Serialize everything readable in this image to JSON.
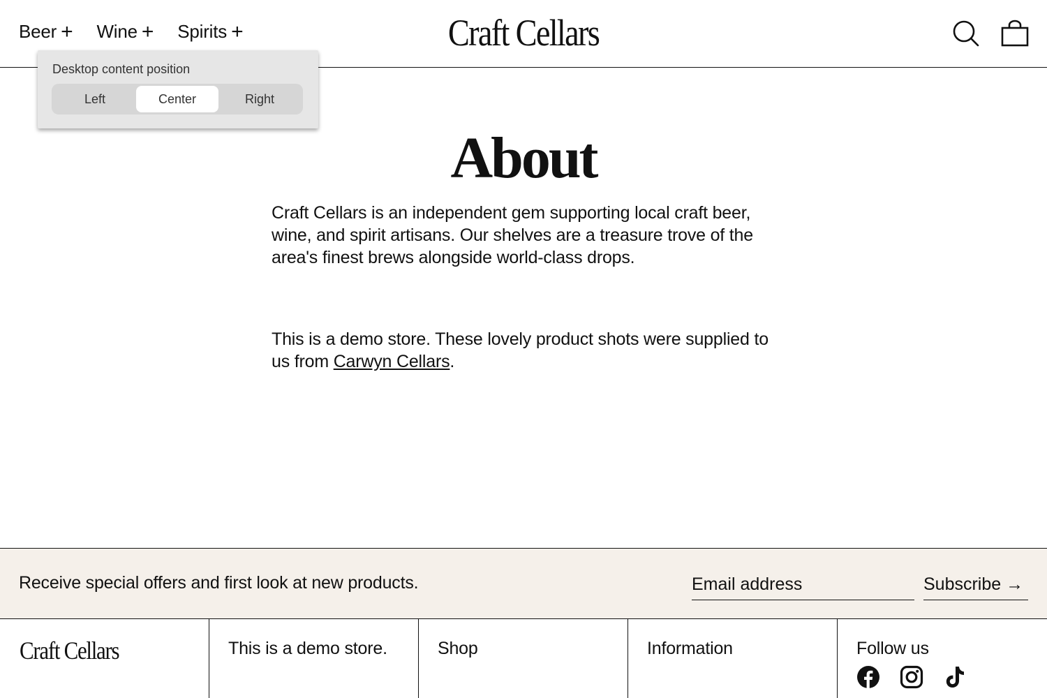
{
  "header": {
    "nav": [
      {
        "label": "Beer",
        "icon": "plus-icon"
      },
      {
        "label": "Wine",
        "icon": "plus-icon"
      },
      {
        "label": "Spirits",
        "icon": "plus-icon"
      }
    ],
    "logo": "Craft Cellars",
    "icons": [
      "search-icon",
      "cart-bag-icon"
    ]
  },
  "popup": {
    "title": "Desktop content position",
    "options": [
      "Left",
      "Center",
      "Right"
    ],
    "selected": "Center"
  },
  "main": {
    "title": "About",
    "paragraph1": "Craft Cellars is an independent gem supporting local craft beer, wine, and spirit artisans. Our shelves are a treasure trove of the area's finest brews alongside world-class drops.",
    "paragraph2_prefix": "This is a demo store. These lovely product shots were supplied to us from ",
    "paragraph2_link": "Carwyn Cellars",
    "paragraph2_suffix": "."
  },
  "newsletter": {
    "text": "Receive special offers and first look at new products.",
    "email_placeholder": "Email address",
    "subscribe_label": "Subscribe →",
    "background": "#f5f0ea"
  },
  "footer": {
    "logo": "Craft Cellars",
    "demo_text": "This is a demo store.",
    "shop_heading": "Shop",
    "info_heading": "Information",
    "follow_heading": "Follow us",
    "social_icons": [
      "facebook-icon",
      "instagram-icon",
      "tiktok-icon"
    ]
  }
}
